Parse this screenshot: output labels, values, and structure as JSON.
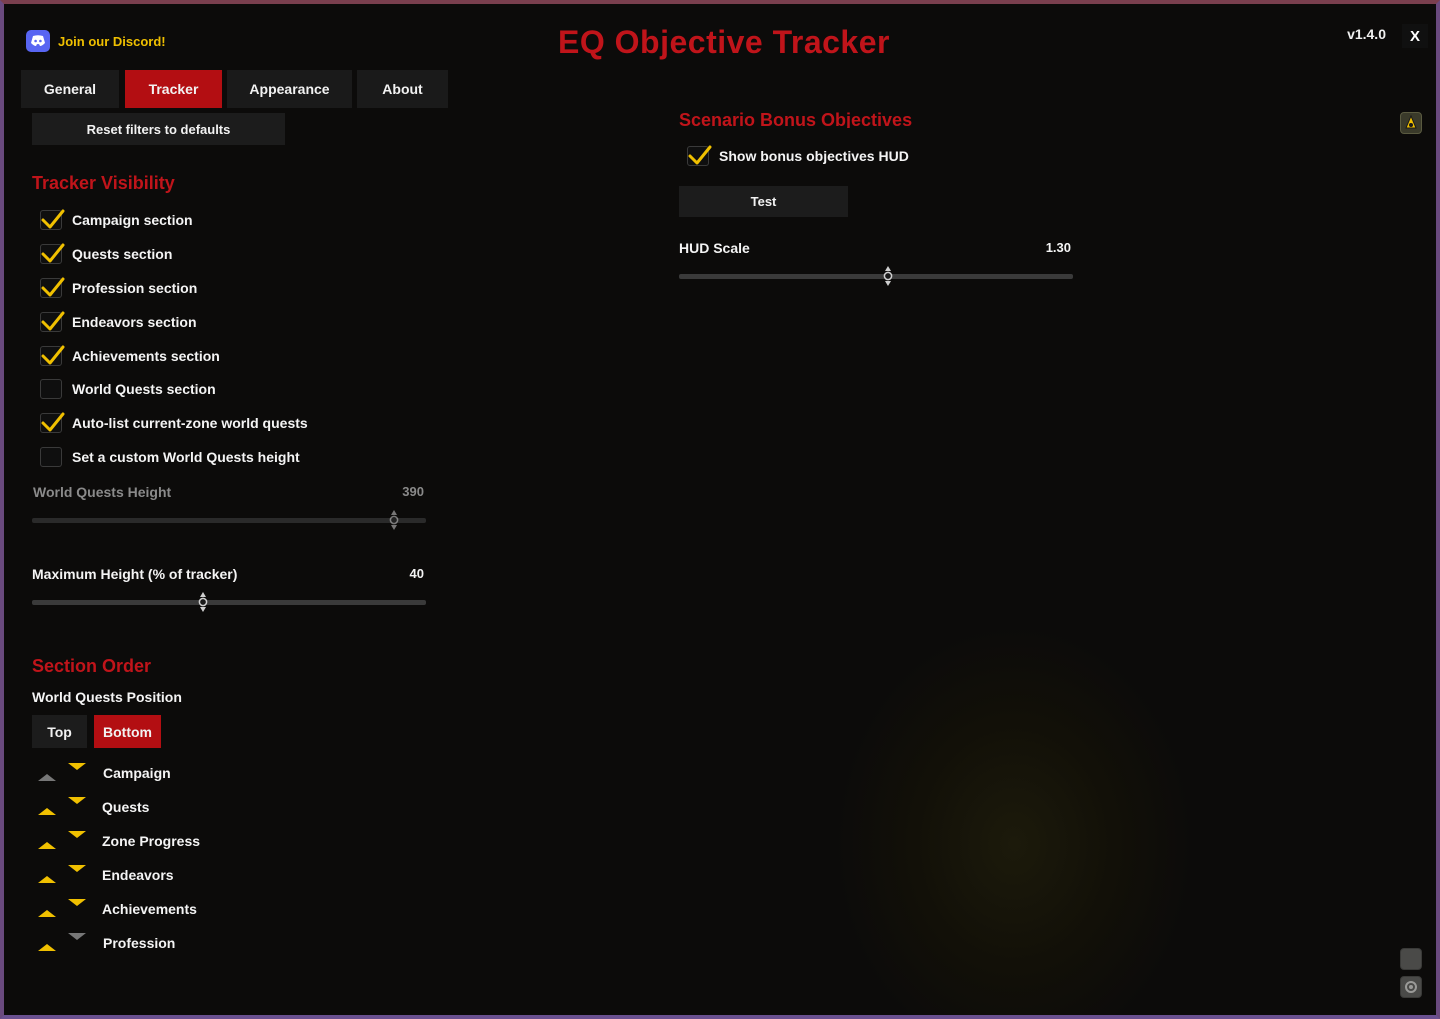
{
  "header": {
    "discord_label": "Join our Discord!",
    "title": "EQ Objective Tracker",
    "version": "v1.4.0",
    "close_label": "X"
  },
  "tabs": [
    {
      "label": "General",
      "active": false
    },
    {
      "label": "Tracker",
      "active": true
    },
    {
      "label": "Appearance",
      "active": false
    },
    {
      "label": "About",
      "active": false
    }
  ],
  "reset_label": "Reset filters to defaults",
  "visibility": {
    "title": "Tracker Visibility",
    "items": [
      {
        "label": "Campaign section",
        "checked": true
      },
      {
        "label": "Quests section",
        "checked": true
      },
      {
        "label": "Profession section",
        "checked": true
      },
      {
        "label": "Endeavors section",
        "checked": true
      },
      {
        "label": "Achievements section",
        "checked": true
      },
      {
        "label": "World Quests section",
        "checked": false
      },
      {
        "label": "Auto-list current-zone world quests",
        "checked": true
      },
      {
        "label": "Set a custom World Quests height",
        "checked": false
      }
    ]
  },
  "sliders": {
    "wq_height": {
      "label": "World Quests Height",
      "value": "390",
      "fraction": 0.92,
      "disabled": true
    },
    "max_height": {
      "label": "Maximum Height (% of tracker)",
      "value": "40",
      "fraction": 0.435,
      "disabled": false
    },
    "hud_scale": {
      "label": "HUD Scale",
      "value": "1.30",
      "fraction": 0.53,
      "disabled": false
    }
  },
  "section_order": {
    "title": "Section Order",
    "wq_position_label": "World Quests Position",
    "position_options": [
      {
        "label": "Top",
        "active": false
      },
      {
        "label": "Bottom",
        "active": true
      }
    ],
    "items": [
      {
        "label": "Campaign",
        "up_enabled": false,
        "down_enabled": true
      },
      {
        "label": "Quests",
        "up_enabled": true,
        "down_enabled": true
      },
      {
        "label": "Zone Progress",
        "up_enabled": true,
        "down_enabled": true
      },
      {
        "label": "Endeavors",
        "up_enabled": true,
        "down_enabled": true
      },
      {
        "label": "Achievements",
        "up_enabled": true,
        "down_enabled": true
      },
      {
        "label": "Profession",
        "up_enabled": true,
        "down_enabled": false
      }
    ]
  },
  "scenario": {
    "title": "Scenario Bonus Objectives",
    "show_hud_label": "Show bonus objectives HUD",
    "show_hud_checked": true,
    "test_label": "Test"
  },
  "colors": {
    "accent_red": "#b30e12",
    "title_red": "#c0141a",
    "gold": "#f0c000",
    "discord": "#5865f2"
  }
}
